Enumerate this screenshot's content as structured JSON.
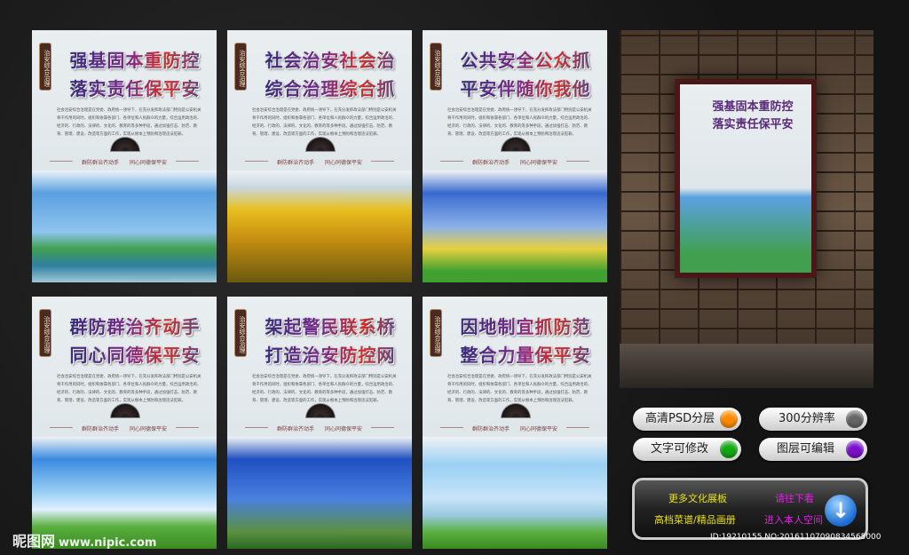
{
  "poster_common": {
    "vertical_label": "治安综合治理",
    "body": "社会治安综合治理是在党委、政府统一领导下，在充分发挥政法部门特别是公安机关骨干作用的同时，组织和依靠各部门、各单位和人民群众的力量，综合运用政治的、经济的、行政的、法律的、文化的、教育的等多种手段，通过加强打击、防范、教育、管理、建设、改造等方面的工作，实现从根本上预防和治理违法犯罪。",
    "slogan_left": "群防群治齐动手",
    "slogan_right": "同心同德保平安"
  },
  "posters": [
    {
      "line1": "强基固本重防控",
      "line2": "落实责任保平安",
      "scene": "city"
    },
    {
      "line1": "社会治安社会治",
      "line2": "综合治理综合抓",
      "scene": "sunflower"
    },
    {
      "line1": "公共安全公众抓",
      "line2": "平安伴随你我他",
      "scene": "tulip"
    },
    {
      "line1": "群防群治齐动手",
      "line2": "同心同德保平安",
      "scene": "sky"
    },
    {
      "line1": "架起警民联系桥",
      "line2": "打造治安防控网",
      "scene": "daffodil"
    },
    {
      "line1": "因地制宜抓防范",
      "line2": "整合力量保平安",
      "scene": "tree"
    }
  ],
  "features": [
    {
      "label": "高清PSD分层",
      "color": "#ff8c00"
    },
    {
      "label": "300分辨率",
      "color": "#666666"
    },
    {
      "label": "文字可修改",
      "color": "#11aa11"
    },
    {
      "label": "图层可编辑",
      "color": "#7a11cc"
    }
  ],
  "banner": {
    "more": "更多文化展板",
    "menu": "高档菜谱/精品画册",
    "see": "请往下看",
    "enter": "进入本人空间"
  },
  "ident": "ID:19210155 NO:20161107090834565000",
  "watermark": {
    "name": "昵图网",
    "url": "www.nipic.com"
  }
}
